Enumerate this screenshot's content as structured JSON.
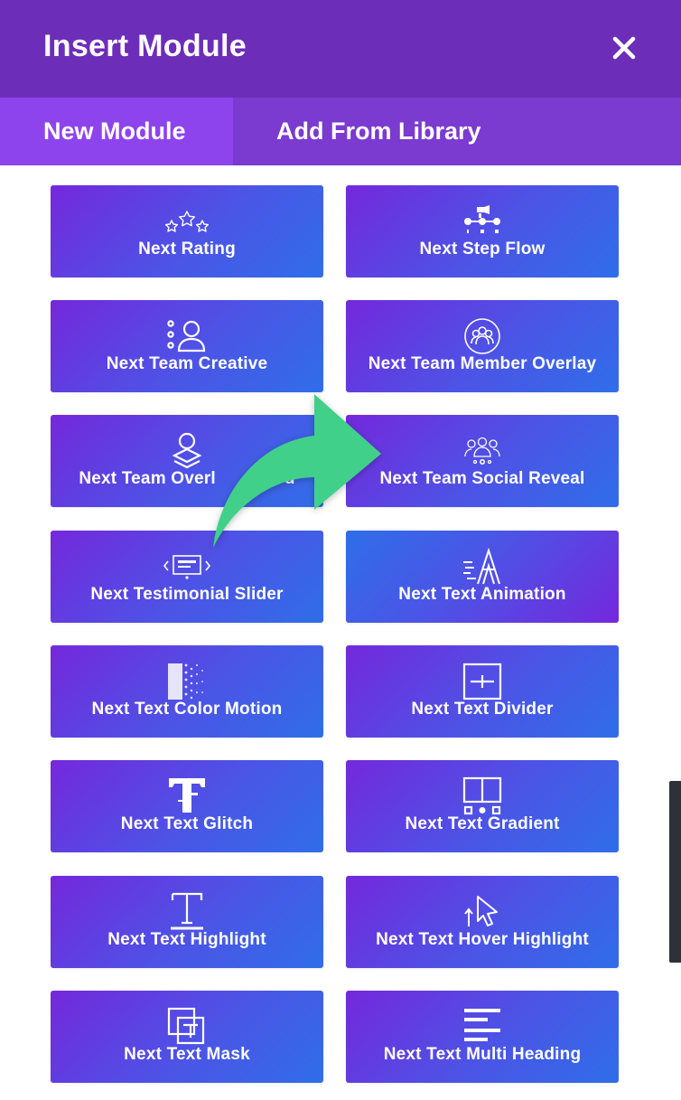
{
  "header": {
    "title": "Insert Module",
    "close_icon": "close-icon"
  },
  "tabs": [
    {
      "label": "New Module",
      "active": true
    },
    {
      "label": "Add From Library",
      "active": false
    }
  ],
  "modules": [
    {
      "label": "Next Rating",
      "icon": "rating-stars-icon"
    },
    {
      "label": "Next Step Flow",
      "icon": "step-flow-icon"
    },
    {
      "label": "Next Team Creative",
      "icon": "team-creative-icon"
    },
    {
      "label": "Next Team Member Overlay",
      "icon": "team-member-overlay-icon"
    },
    {
      "label": "Next Team Overl",
      "label_tail": "d",
      "icon": "team-overlay-card-icon"
    },
    {
      "label": "Next Team Social Reveal",
      "icon": "team-social-reveal-icon"
    },
    {
      "label": "Next Testimonial Slider",
      "icon": "testimonial-slider-icon"
    },
    {
      "label": "Next Text Animation",
      "icon": "text-animation-icon"
    },
    {
      "label": "Next Text Color Motion",
      "icon": "text-color-motion-icon"
    },
    {
      "label": "Next Text Divider",
      "icon": "text-divider-icon"
    },
    {
      "label": "Next Text Glitch",
      "icon": "text-glitch-icon"
    },
    {
      "label": "Next Text Gradient",
      "icon": "text-gradient-icon"
    },
    {
      "label": "Next Text Highlight",
      "icon": "text-highlight-icon"
    },
    {
      "label": "Next Text Hover Highlight",
      "icon": "text-hover-highlight-icon"
    },
    {
      "label": "Next Text Mask",
      "icon": "text-mask-icon"
    },
    {
      "label": "Next Text Multi Heading",
      "icon": "text-multi-heading-icon"
    }
  ],
  "overlay": {
    "icon": "curved-arrow-icon",
    "color": "#3fd08a"
  },
  "colors": {
    "header": "#6c2eb9",
    "tabs_bar": "#7b3ad0",
    "active_tab": "#8e44ec",
    "module_gradient_start": "#7428dc",
    "module_gradient_end": "#2f6ee8"
  }
}
